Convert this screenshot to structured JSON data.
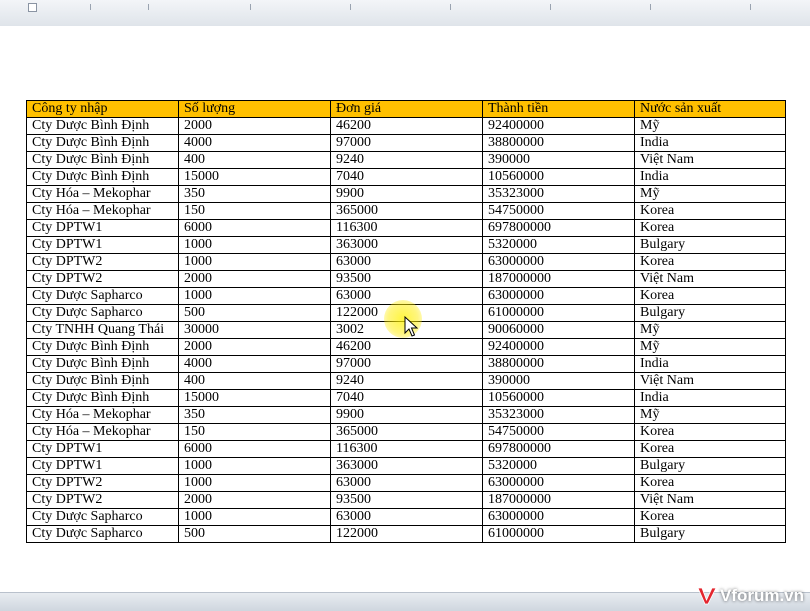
{
  "table": {
    "headers": [
      "Công ty nhập",
      "Số lượng",
      "Đơn giá",
      "Thành tiền",
      "Nước sản xuất"
    ],
    "rows": [
      [
        "Cty Dược Bình Định",
        "2000",
        "46200",
        "92400000",
        "Mỹ"
      ],
      [
        "Cty Dược Bình Định",
        "4000",
        "97000",
        "38800000",
        "India"
      ],
      [
        "Cty Dược Bình Định",
        "400",
        "9240",
        "390000",
        "Việt Nam"
      ],
      [
        "Cty Dược Bình Định",
        "15000",
        "7040",
        "10560000",
        "India"
      ],
      [
        "Cty Hóa – Mekophar",
        "350",
        "9900",
        "35323000",
        "Mỹ"
      ],
      [
        "Cty Hóa – Mekophar",
        "150",
        "365000",
        "54750000",
        "Korea"
      ],
      [
        "Cty DPTW1",
        "6000",
        "116300",
        "697800000",
        "Korea"
      ],
      [
        "Cty DPTW1",
        "1000",
        "363000",
        "5320000",
        "Bulgary"
      ],
      [
        "Cty DPTW2",
        "1000",
        "63000",
        "63000000",
        "Korea"
      ],
      [
        "Cty DPTW2",
        "2000",
        "93500",
        "187000000",
        "Việt Nam"
      ],
      [
        "Cty Dược Sapharco",
        "1000",
        "63000",
        "63000000",
        "Korea"
      ],
      [
        "Cty Dược Sapharco",
        "500",
        "122000",
        "61000000",
        "Bulgary"
      ],
      [
        "Cty TNHH Quang Thái",
        "30000",
        "3002",
        "90060000",
        "Mỹ"
      ],
      [
        "Cty Dược Bình Định",
        "2000",
        "46200",
        "92400000",
        "Mỹ"
      ],
      [
        "Cty Dược Bình Định",
        "4000",
        "97000",
        "38800000",
        "India"
      ],
      [
        "Cty Dược Bình Định",
        "400",
        "9240",
        "390000",
        "Việt Nam"
      ],
      [
        "Cty Dược Bình Định",
        "15000",
        "7040",
        "10560000",
        "India"
      ],
      [
        "Cty Hóa – Mekophar",
        "350",
        "9900",
        "35323000",
        "Mỹ"
      ],
      [
        "Cty Hóa – Mekophar",
        "150",
        "365000",
        "54750000",
        "Korea"
      ],
      [
        "Cty DPTW1",
        "6000",
        "116300",
        "697800000",
        "Korea"
      ],
      [
        "Cty DPTW1",
        "1000",
        "363000",
        "5320000",
        "Bulgary"
      ],
      [
        "Cty DPTW2",
        "1000",
        "63000",
        "63000000",
        "Korea"
      ],
      [
        "Cty DPTW2",
        "2000",
        "93500",
        "187000000",
        "Việt Nam"
      ],
      [
        "Cty Dược Sapharco",
        "1000",
        "63000",
        "63000000",
        "Korea"
      ],
      [
        "Cty Dược Sapharco",
        "500",
        "122000",
        "61000000",
        "Bulgary"
      ]
    ]
  },
  "colors": {
    "header_fill": "#ffc000",
    "border": "#000000",
    "cursor_highlight": "#fff200"
  },
  "icons": {
    "cursor": "mouse-pointer-icon",
    "watermark_logo": "vforum-logo-icon"
  },
  "watermark": {
    "text": "Vforum.vn"
  }
}
